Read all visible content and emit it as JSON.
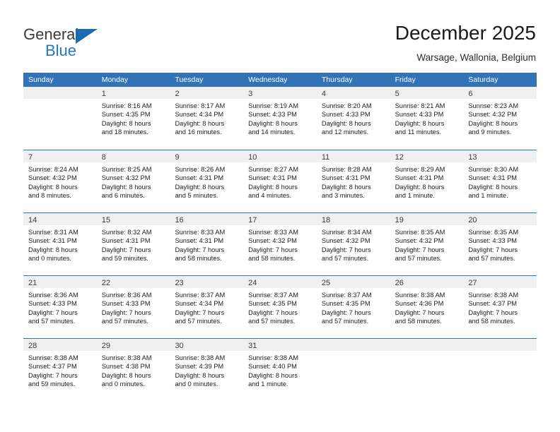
{
  "brand": {
    "name_top": "General",
    "name_bottom": "Blue",
    "color_dark": "#3b3b3b",
    "color_blue": "#1d79c4"
  },
  "header": {
    "title": "December 2025",
    "subtitle": "Warsage, Wallonia, Belgium"
  },
  "theme": {
    "header_blue": "#3173b6",
    "daynum_band": "#f0f0f0",
    "text": "#1c1c1c"
  },
  "weekdays": [
    "Sunday",
    "Monday",
    "Tuesday",
    "Wednesday",
    "Thursday",
    "Friday",
    "Saturday"
  ],
  "weeks": [
    [
      {
        "day": "",
        "lines": []
      },
      {
        "day": "1",
        "lines": [
          "Sunrise: 8:16 AM",
          "Sunset: 4:35 PM",
          "Daylight: 8 hours",
          "and 18 minutes."
        ]
      },
      {
        "day": "2",
        "lines": [
          "Sunrise: 8:17 AM",
          "Sunset: 4:34 PM",
          "Daylight: 8 hours",
          "and 16 minutes."
        ]
      },
      {
        "day": "3",
        "lines": [
          "Sunrise: 8:19 AM",
          "Sunset: 4:33 PM",
          "Daylight: 8 hours",
          "and 14 minutes."
        ]
      },
      {
        "day": "4",
        "lines": [
          "Sunrise: 8:20 AM",
          "Sunset: 4:33 PM",
          "Daylight: 8 hours",
          "and 12 minutes."
        ]
      },
      {
        "day": "5",
        "lines": [
          "Sunrise: 8:21 AM",
          "Sunset: 4:33 PM",
          "Daylight: 8 hours",
          "and 11 minutes."
        ]
      },
      {
        "day": "6",
        "lines": [
          "Sunrise: 8:23 AM",
          "Sunset: 4:32 PM",
          "Daylight: 8 hours",
          "and 9 minutes."
        ]
      }
    ],
    [
      {
        "day": "7",
        "lines": [
          "Sunrise: 8:24 AM",
          "Sunset: 4:32 PM",
          "Daylight: 8 hours",
          "and 8 minutes."
        ]
      },
      {
        "day": "8",
        "lines": [
          "Sunrise: 8:25 AM",
          "Sunset: 4:32 PM",
          "Daylight: 8 hours",
          "and 6 minutes."
        ]
      },
      {
        "day": "9",
        "lines": [
          "Sunrise: 8:26 AM",
          "Sunset: 4:31 PM",
          "Daylight: 8 hours",
          "and 5 minutes."
        ]
      },
      {
        "day": "10",
        "lines": [
          "Sunrise: 8:27 AM",
          "Sunset: 4:31 PM",
          "Daylight: 8 hours",
          "and 4 minutes."
        ]
      },
      {
        "day": "11",
        "lines": [
          "Sunrise: 8:28 AM",
          "Sunset: 4:31 PM",
          "Daylight: 8 hours",
          "and 3 minutes."
        ]
      },
      {
        "day": "12",
        "lines": [
          "Sunrise: 8:29 AM",
          "Sunset: 4:31 PM",
          "Daylight: 8 hours",
          "and 1 minute."
        ]
      },
      {
        "day": "13",
        "lines": [
          "Sunrise: 8:30 AM",
          "Sunset: 4:31 PM",
          "Daylight: 8 hours",
          "and 1 minute."
        ]
      }
    ],
    [
      {
        "day": "14",
        "lines": [
          "Sunrise: 8:31 AM",
          "Sunset: 4:31 PM",
          "Daylight: 8 hours",
          "and 0 minutes."
        ]
      },
      {
        "day": "15",
        "lines": [
          "Sunrise: 8:32 AM",
          "Sunset: 4:31 PM",
          "Daylight: 7 hours",
          "and 59 minutes."
        ]
      },
      {
        "day": "16",
        "lines": [
          "Sunrise: 8:33 AM",
          "Sunset: 4:31 PM",
          "Daylight: 7 hours",
          "and 58 minutes."
        ]
      },
      {
        "day": "17",
        "lines": [
          "Sunrise: 8:33 AM",
          "Sunset: 4:32 PM",
          "Daylight: 7 hours",
          "and 58 minutes."
        ]
      },
      {
        "day": "18",
        "lines": [
          "Sunrise: 8:34 AM",
          "Sunset: 4:32 PM",
          "Daylight: 7 hours",
          "and 57 minutes."
        ]
      },
      {
        "day": "19",
        "lines": [
          "Sunrise: 8:35 AM",
          "Sunset: 4:32 PM",
          "Daylight: 7 hours",
          "and 57 minutes."
        ]
      },
      {
        "day": "20",
        "lines": [
          "Sunrise: 8:35 AM",
          "Sunset: 4:33 PM",
          "Daylight: 7 hours",
          "and 57 minutes."
        ]
      }
    ],
    [
      {
        "day": "21",
        "lines": [
          "Sunrise: 8:36 AM",
          "Sunset: 4:33 PM",
          "Daylight: 7 hours",
          "and 57 minutes."
        ]
      },
      {
        "day": "22",
        "lines": [
          "Sunrise: 8:36 AM",
          "Sunset: 4:33 PM",
          "Daylight: 7 hours",
          "and 57 minutes."
        ]
      },
      {
        "day": "23",
        "lines": [
          "Sunrise: 8:37 AM",
          "Sunset: 4:34 PM",
          "Daylight: 7 hours",
          "and 57 minutes."
        ]
      },
      {
        "day": "24",
        "lines": [
          "Sunrise: 8:37 AM",
          "Sunset: 4:35 PM",
          "Daylight: 7 hours",
          "and 57 minutes."
        ]
      },
      {
        "day": "25",
        "lines": [
          "Sunrise: 8:37 AM",
          "Sunset: 4:35 PM",
          "Daylight: 7 hours",
          "and 57 minutes."
        ]
      },
      {
        "day": "26",
        "lines": [
          "Sunrise: 8:38 AM",
          "Sunset: 4:36 PM",
          "Daylight: 7 hours",
          "and 58 minutes."
        ]
      },
      {
        "day": "27",
        "lines": [
          "Sunrise: 8:38 AM",
          "Sunset: 4:37 PM",
          "Daylight: 7 hours",
          "and 58 minutes."
        ]
      }
    ],
    [
      {
        "day": "28",
        "lines": [
          "Sunrise: 8:38 AM",
          "Sunset: 4:37 PM",
          "Daylight: 7 hours",
          "and 59 minutes."
        ]
      },
      {
        "day": "29",
        "lines": [
          "Sunrise: 8:38 AM",
          "Sunset: 4:38 PM",
          "Daylight: 8 hours",
          "and 0 minutes."
        ]
      },
      {
        "day": "30",
        "lines": [
          "Sunrise: 8:38 AM",
          "Sunset: 4:39 PM",
          "Daylight: 8 hours",
          "and 0 minutes."
        ]
      },
      {
        "day": "31",
        "lines": [
          "Sunrise: 8:38 AM",
          "Sunset: 4:40 PM",
          "Daylight: 8 hours",
          "and 1 minute."
        ]
      },
      {
        "day": "",
        "lines": []
      },
      {
        "day": "",
        "lines": []
      },
      {
        "day": "",
        "lines": []
      }
    ]
  ]
}
